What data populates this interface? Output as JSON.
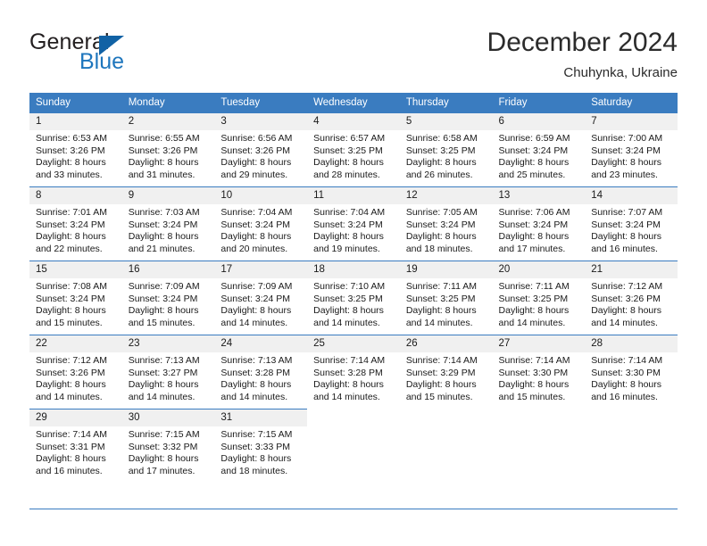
{
  "brand": {
    "name_part1": "General",
    "name_part2": "Blue",
    "mark": "triangle-logo"
  },
  "header": {
    "title": "December 2024",
    "location": "Chuhynka, Ukraine"
  },
  "calendar": {
    "weekday_headers": [
      "Sunday",
      "Monday",
      "Tuesday",
      "Wednesday",
      "Thursday",
      "Friday",
      "Saturday"
    ],
    "accent_color": "#3a7cc0",
    "daynum_bg": "#f0f0f0",
    "weeks": [
      [
        {
          "day": "1",
          "sunrise": "Sunrise: 6:53 AM",
          "sunset": "Sunset: 3:26 PM",
          "daylight1": "Daylight: 8 hours",
          "daylight2": "and 33 minutes."
        },
        {
          "day": "2",
          "sunrise": "Sunrise: 6:55 AM",
          "sunset": "Sunset: 3:26 PM",
          "daylight1": "Daylight: 8 hours",
          "daylight2": "and 31 minutes."
        },
        {
          "day": "3",
          "sunrise": "Sunrise: 6:56 AM",
          "sunset": "Sunset: 3:26 PM",
          "daylight1": "Daylight: 8 hours",
          "daylight2": "and 29 minutes."
        },
        {
          "day": "4",
          "sunrise": "Sunrise: 6:57 AM",
          "sunset": "Sunset: 3:25 PM",
          "daylight1": "Daylight: 8 hours",
          "daylight2": "and 28 minutes."
        },
        {
          "day": "5",
          "sunrise": "Sunrise: 6:58 AM",
          "sunset": "Sunset: 3:25 PM",
          "daylight1": "Daylight: 8 hours",
          "daylight2": "and 26 minutes."
        },
        {
          "day": "6",
          "sunrise": "Sunrise: 6:59 AM",
          "sunset": "Sunset: 3:24 PM",
          "daylight1": "Daylight: 8 hours",
          "daylight2": "and 25 minutes."
        },
        {
          "day": "7",
          "sunrise": "Sunrise: 7:00 AM",
          "sunset": "Sunset: 3:24 PM",
          "daylight1": "Daylight: 8 hours",
          "daylight2": "and 23 minutes."
        }
      ],
      [
        {
          "day": "8",
          "sunrise": "Sunrise: 7:01 AM",
          "sunset": "Sunset: 3:24 PM",
          "daylight1": "Daylight: 8 hours",
          "daylight2": "and 22 minutes."
        },
        {
          "day": "9",
          "sunrise": "Sunrise: 7:03 AM",
          "sunset": "Sunset: 3:24 PM",
          "daylight1": "Daylight: 8 hours",
          "daylight2": "and 21 minutes."
        },
        {
          "day": "10",
          "sunrise": "Sunrise: 7:04 AM",
          "sunset": "Sunset: 3:24 PM",
          "daylight1": "Daylight: 8 hours",
          "daylight2": "and 20 minutes."
        },
        {
          "day": "11",
          "sunrise": "Sunrise: 7:04 AM",
          "sunset": "Sunset: 3:24 PM",
          "daylight1": "Daylight: 8 hours",
          "daylight2": "and 19 minutes."
        },
        {
          "day": "12",
          "sunrise": "Sunrise: 7:05 AM",
          "sunset": "Sunset: 3:24 PM",
          "daylight1": "Daylight: 8 hours",
          "daylight2": "and 18 minutes."
        },
        {
          "day": "13",
          "sunrise": "Sunrise: 7:06 AM",
          "sunset": "Sunset: 3:24 PM",
          "daylight1": "Daylight: 8 hours",
          "daylight2": "and 17 minutes."
        },
        {
          "day": "14",
          "sunrise": "Sunrise: 7:07 AM",
          "sunset": "Sunset: 3:24 PM",
          "daylight1": "Daylight: 8 hours",
          "daylight2": "and 16 minutes."
        }
      ],
      [
        {
          "day": "15",
          "sunrise": "Sunrise: 7:08 AM",
          "sunset": "Sunset: 3:24 PM",
          "daylight1": "Daylight: 8 hours",
          "daylight2": "and 15 minutes."
        },
        {
          "day": "16",
          "sunrise": "Sunrise: 7:09 AM",
          "sunset": "Sunset: 3:24 PM",
          "daylight1": "Daylight: 8 hours",
          "daylight2": "and 15 minutes."
        },
        {
          "day": "17",
          "sunrise": "Sunrise: 7:09 AM",
          "sunset": "Sunset: 3:24 PM",
          "daylight1": "Daylight: 8 hours",
          "daylight2": "and 14 minutes."
        },
        {
          "day": "18",
          "sunrise": "Sunrise: 7:10 AM",
          "sunset": "Sunset: 3:25 PM",
          "daylight1": "Daylight: 8 hours",
          "daylight2": "and 14 minutes."
        },
        {
          "day": "19",
          "sunrise": "Sunrise: 7:11 AM",
          "sunset": "Sunset: 3:25 PM",
          "daylight1": "Daylight: 8 hours",
          "daylight2": "and 14 minutes."
        },
        {
          "day": "20",
          "sunrise": "Sunrise: 7:11 AM",
          "sunset": "Sunset: 3:25 PM",
          "daylight1": "Daylight: 8 hours",
          "daylight2": "and 14 minutes."
        },
        {
          "day": "21",
          "sunrise": "Sunrise: 7:12 AM",
          "sunset": "Sunset: 3:26 PM",
          "daylight1": "Daylight: 8 hours",
          "daylight2": "and 14 minutes."
        }
      ],
      [
        {
          "day": "22",
          "sunrise": "Sunrise: 7:12 AM",
          "sunset": "Sunset: 3:26 PM",
          "daylight1": "Daylight: 8 hours",
          "daylight2": "and 14 minutes."
        },
        {
          "day": "23",
          "sunrise": "Sunrise: 7:13 AM",
          "sunset": "Sunset: 3:27 PM",
          "daylight1": "Daylight: 8 hours",
          "daylight2": "and 14 minutes."
        },
        {
          "day": "24",
          "sunrise": "Sunrise: 7:13 AM",
          "sunset": "Sunset: 3:28 PM",
          "daylight1": "Daylight: 8 hours",
          "daylight2": "and 14 minutes."
        },
        {
          "day": "25",
          "sunrise": "Sunrise: 7:14 AM",
          "sunset": "Sunset: 3:28 PM",
          "daylight1": "Daylight: 8 hours",
          "daylight2": "and 14 minutes."
        },
        {
          "day": "26",
          "sunrise": "Sunrise: 7:14 AM",
          "sunset": "Sunset: 3:29 PM",
          "daylight1": "Daylight: 8 hours",
          "daylight2": "and 15 minutes."
        },
        {
          "day": "27",
          "sunrise": "Sunrise: 7:14 AM",
          "sunset": "Sunset: 3:30 PM",
          "daylight1": "Daylight: 8 hours",
          "daylight2": "and 15 minutes."
        },
        {
          "day": "28",
          "sunrise": "Sunrise: 7:14 AM",
          "sunset": "Sunset: 3:30 PM",
          "daylight1": "Daylight: 8 hours",
          "daylight2": "and 16 minutes."
        }
      ],
      [
        {
          "day": "29",
          "sunrise": "Sunrise: 7:14 AM",
          "sunset": "Sunset: 3:31 PM",
          "daylight1": "Daylight: 8 hours",
          "daylight2": "and 16 minutes."
        },
        {
          "day": "30",
          "sunrise": "Sunrise: 7:15 AM",
          "sunset": "Sunset: 3:32 PM",
          "daylight1": "Daylight: 8 hours",
          "daylight2": "and 17 minutes."
        },
        {
          "day": "31",
          "sunrise": "Sunrise: 7:15 AM",
          "sunset": "Sunset: 3:33 PM",
          "daylight1": "Daylight: 8 hours",
          "daylight2": "and 18 minutes."
        },
        {
          "day": "",
          "sunrise": "",
          "sunset": "",
          "daylight1": "",
          "daylight2": ""
        },
        {
          "day": "",
          "sunrise": "",
          "sunset": "",
          "daylight1": "",
          "daylight2": ""
        },
        {
          "day": "",
          "sunrise": "",
          "sunset": "",
          "daylight1": "",
          "daylight2": ""
        },
        {
          "day": "",
          "sunrise": "",
          "sunset": "",
          "daylight1": "",
          "daylight2": ""
        }
      ]
    ]
  }
}
